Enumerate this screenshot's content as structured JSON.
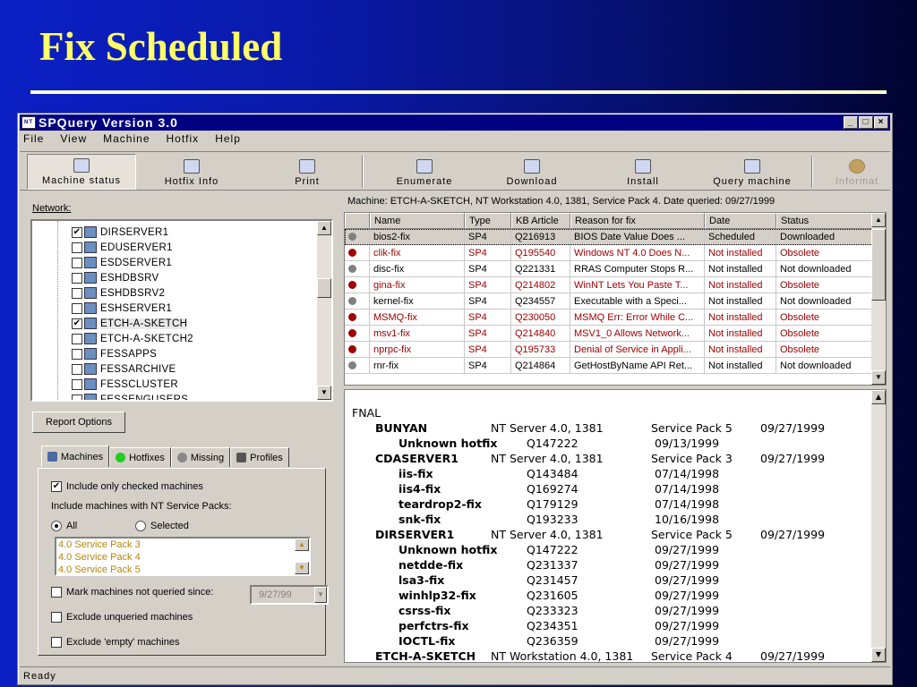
{
  "slide": {
    "title": "Fix Scheduled"
  },
  "window": {
    "title": "SPQuery Version 3.0",
    "icon": "server-icon",
    "min": "_",
    "max": "□",
    "close": "×"
  },
  "menu": [
    "File",
    "View",
    "Machine",
    "Hotfix",
    "Help"
  ],
  "toolbar": {
    "machine_status": "Machine status",
    "hotfix_info": "Hotfix Info",
    "print": "Print",
    "enumerate": "Enumerate",
    "download": "Download",
    "install": "Install",
    "query_machine": "Query machine",
    "information": "Informat"
  },
  "network": {
    "label": "Network:",
    "items": [
      {
        "name": "DIRSERVER1",
        "checked": true
      },
      {
        "name": "EDUSERVER1",
        "checked": false
      },
      {
        "name": "ESDSERVER1",
        "checked": false
      },
      {
        "name": "ESHDBSRV",
        "checked": false
      },
      {
        "name": "ESHDBSRV2",
        "checked": false
      },
      {
        "name": "ESHSERVER1",
        "checked": false
      },
      {
        "name": "ETCH-A-SKETCH",
        "checked": true
      },
      {
        "name": "ETCH-A-SKETCH2",
        "checked": false
      },
      {
        "name": "FESSAPPS",
        "checked": false
      },
      {
        "name": "FESSARCHIVE",
        "checked": false
      },
      {
        "name": "FESSCLUSTER",
        "checked": false
      },
      {
        "name": "FESSENGUSERS",
        "checked": false
      }
    ]
  },
  "report_options": "Report Options",
  "tabs": [
    "Machines",
    "Hotfixes",
    "Missing",
    "Profiles"
  ],
  "options": {
    "include_checked": "Include only checked machines",
    "include_sp_label": "Include machines with NT Service Packs:",
    "all": "All",
    "selected": "Selected",
    "service_packs": [
      "4.0 Service Pack 3",
      "4.0 Service Pack 4",
      "4.0 Service Pack 5"
    ],
    "mark_not_queried": "Mark machines not queried since:",
    "date": "9/27/99",
    "exclude_unqueried": "Exclude unqueried machines",
    "exclude_empty": "Exclude 'empty' machines"
  },
  "machine_info": "Machine: ETCH-A-SKETCH, NT Workstation 4.0, 1381, Service Pack 4.  Date queried: 09/27/1999",
  "grid": {
    "columns": [
      "",
      "Name",
      "Type",
      "KB Article",
      "Reason for fix",
      "Date",
      "Status"
    ],
    "rows": [
      {
        "name": "bios2-fix",
        "type": "SP4",
        "kb": "Q216913",
        "reason": "BIOS Date Value Does ...",
        "date": "Scheduled",
        "status": "Downloaded",
        "color": "#000000",
        "dot": "#808080"
      },
      {
        "name": "clik-fix",
        "type": "SP4",
        "kb": "Q195540",
        "reason": "Windows NT 4.0 Does N...",
        "date": "Not installed",
        "status": "Obsolete",
        "color": "#a00000",
        "dot": "#a00000"
      },
      {
        "name": "disc-fix",
        "type": "SP4",
        "kb": "Q221331",
        "reason": "RRAS Computer Stops R...",
        "date": "Not installed",
        "status": "Not downloaded",
        "color": "#000000",
        "dot": "#808080"
      },
      {
        "name": "gina-fix",
        "type": "SP4",
        "kb": "Q214802",
        "reason": "WinNT Lets You Paste T...",
        "date": "Not installed",
        "status": "Obsolete",
        "color": "#a00000",
        "dot": "#a00000"
      },
      {
        "name": "kernel-fix",
        "type": "SP4",
        "kb": "Q234557",
        "reason": "Executable with a Speci...",
        "date": "Not installed",
        "status": "Not downloaded",
        "color": "#000000",
        "dot": "#808080"
      },
      {
        "name": "MSMQ-fix",
        "type": "SP4",
        "kb": "Q230050",
        "reason": "MSMQ Err: Error While C...",
        "date": "Not installed",
        "status": "Obsolete",
        "color": "#a00000",
        "dot": "#a00000"
      },
      {
        "name": "msv1-fix",
        "type": "SP4",
        "kb": "Q214840",
        "reason": "MSV1_0 Allows Network...",
        "date": "Not installed",
        "status": "Obsolete",
        "color": "#a00000",
        "dot": "#a00000"
      },
      {
        "name": "nprpc-fix",
        "type": "SP4",
        "kb": "Q195733",
        "reason": "Denial of Service in Appli...",
        "date": "Not installed",
        "status": "Obsolete",
        "color": "#a00000",
        "dot": "#a00000"
      },
      {
        "name": "rnr-fix",
        "type": "SP4",
        "kb": "Q214864",
        "reason": "GetHostByName API Ret...",
        "date": "Not installed",
        "status": "Not downloaded",
        "color": "#000000",
        "dot": "#808080"
      }
    ]
  },
  "details": [
    {
      "col1": "FNAL",
      "col2": "",
      "col3": "",
      "col4": "",
      "level": 0
    },
    {
      "col1": "BUNYAN",
      "col2": "NT Server 4.0, 1381",
      "col3": "Service Pack 5",
      "col4": "09/27/1999",
      "level": 1
    },
    {
      "col1": "Unknown hotfix",
      "col2": "Q147222",
      "col3": "09/13/1999",
      "col4": "",
      "level": 2
    },
    {
      "col1": "CDASERVER1",
      "col2": "NT Server 4.0, 1381",
      "col3": "Service Pack 3",
      "col4": "09/27/1999",
      "level": 1
    },
    {
      "col1": "iis-fix",
      "col2": "Q143484",
      "col3": "07/14/1998",
      "col4": "",
      "level": 2
    },
    {
      "col1": "iis4-fix",
      "col2": "Q169274",
      "col3": "07/14/1998",
      "col4": "",
      "level": 2
    },
    {
      "col1": "teardrop2-fix",
      "col2": "Q179129",
      "col3": "07/14/1998",
      "col4": "",
      "level": 2
    },
    {
      "col1": "snk-fix",
      "col2": "Q193233",
      "col3": "10/16/1998",
      "col4": "",
      "level": 2
    },
    {
      "col1": "DIRSERVER1",
      "col2": "NT Server 4.0, 1381",
      "col3": "Service Pack 5",
      "col4": "09/27/1999",
      "level": 1
    },
    {
      "col1": "Unknown hotfix",
      "col2": "Q147222",
      "col3": "09/27/1999",
      "col4": "",
      "level": 2
    },
    {
      "col1": "netdde-fix",
      "col2": "Q231337",
      "col3": "09/27/1999",
      "col4": "",
      "level": 2
    },
    {
      "col1": "lsa3-fix",
      "col2": "Q231457",
      "col3": "09/27/1999",
      "col4": "",
      "level": 2
    },
    {
      "col1": "winhlp32-fix",
      "col2": "Q231605",
      "col3": "09/27/1999",
      "col4": "",
      "level": 2
    },
    {
      "col1": "csrss-fix",
      "col2": "Q233323",
      "col3": "09/27/1999",
      "col4": "",
      "level": 2
    },
    {
      "col1": "perfctrs-fix",
      "col2": "Q234351",
      "col3": "09/27/1999",
      "col4": "",
      "level": 2
    },
    {
      "col1": "IOCTL-fix",
      "col2": "Q236359",
      "col3": "09/27/1999",
      "col4": "",
      "level": 2
    },
    {
      "col1": "ETCH-A-SKETCH",
      "col2": "NT Workstation 4.0, 1381",
      "col3": "Service Pack 4",
      "col4": "09/27/1999",
      "level": 1
    }
  ],
  "status": "Ready"
}
